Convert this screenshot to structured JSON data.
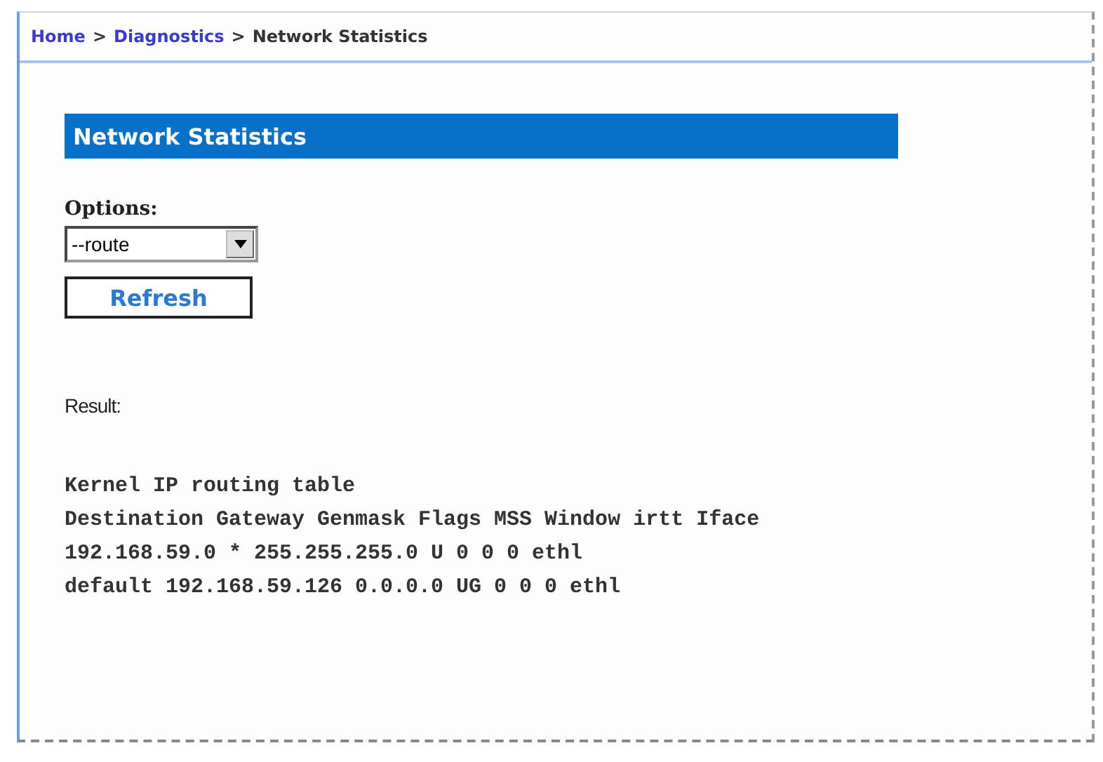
{
  "breadcrumb": {
    "links": [
      "Home",
      "Diagnostics"
    ],
    "separator": ">",
    "current": "Network Statistics"
  },
  "section_title": "Network Statistics",
  "options": {
    "label": "Options:",
    "value": "--route"
  },
  "buttons": [
    "Refresh"
  ],
  "result": {
    "label": "Result:",
    "lines": [
      "Kernel IP routing table",
      "Destination Gateway Genmask Flags MSS Window irtt Iface",
      "192.168.59.0 * 255.255.255.0 U 0 0 0 ethl",
      "default 192.168.59.126 0.0.0.0 UG 0 0 0 ethl"
    ]
  }
}
